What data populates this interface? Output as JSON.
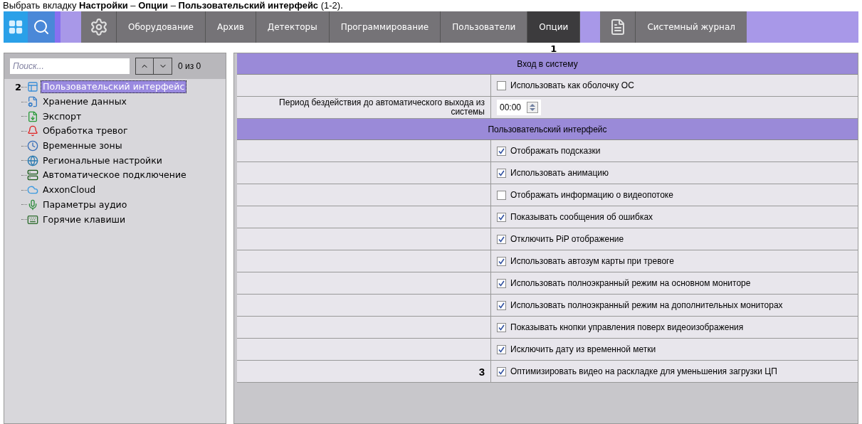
{
  "caption": "Выбрать вкладку **Настройки** – **Опции** – **Пользовательский интерфейс** (1-2).",
  "toolbar": {
    "tabs": [
      {
        "label": "Оборудование",
        "selected": false
      },
      {
        "label": "Архив",
        "selected": false
      },
      {
        "label": "Детекторы",
        "selected": false
      },
      {
        "label": "Программирование",
        "selected": false
      },
      {
        "label": "Пользователи",
        "selected": false
      },
      {
        "label": "Опции",
        "selected": true,
        "callout": "1"
      }
    ],
    "journal": "Системный журнал"
  },
  "sidebar": {
    "search": {
      "placeholder": "Поиск..."
    },
    "counter": "0 из 0",
    "items": [
      {
        "label": "Пользовательский интерфейс",
        "selected": true,
        "callout": "2"
      },
      {
        "label": "Хранение данных",
        "selected": false
      },
      {
        "label": "Экспорт",
        "selected": false
      },
      {
        "label": "Обработка тревог",
        "selected": false
      },
      {
        "label": "Временные зоны",
        "selected": false
      },
      {
        "label": "Региональные настройки",
        "selected": false
      },
      {
        "label": "Автоматическое подключение",
        "selected": false
      },
      {
        "label": "AxxonCloud",
        "selected": false
      },
      {
        "label": "Параметры аудио",
        "selected": false
      },
      {
        "label": "Горячие клавиши",
        "selected": false
      }
    ]
  },
  "sections": [
    {
      "title": "Вход в систему",
      "rows": [
        {
          "kind": "checkbox",
          "text": "Использовать как оболочку ОС",
          "checked": false
        },
        {
          "kind": "time",
          "label": "Период бездействия до автоматического выхода из системы",
          "value": "00:00"
        }
      ]
    },
    {
      "title": "Пользовательский интерфейс",
      "rows": [
        {
          "kind": "checkbox",
          "text": "Отображать подсказки",
          "checked": true
        },
        {
          "kind": "checkbox",
          "text": "Использовать анимацию",
          "checked": true
        },
        {
          "kind": "checkbox",
          "text": "Отображать информацию о видеопотоке",
          "checked": false
        },
        {
          "kind": "checkbox",
          "text": "Показывать сообщения об ошибках",
          "checked": true
        },
        {
          "kind": "checkbox",
          "text": "Отключить PiP отображение",
          "checked": true
        },
        {
          "kind": "checkbox",
          "text": "Использовать автозум карты при тревоге",
          "checked": true
        },
        {
          "kind": "checkbox",
          "text": "Использовать полноэкранный режим на основном мониторе",
          "checked": true
        },
        {
          "kind": "checkbox",
          "text": "Использовать полноэкранный режим на дополнительных мониторах",
          "checked": true
        },
        {
          "kind": "checkbox",
          "text": "Показывать кнопки управления поверх видеоизображения",
          "checked": true
        },
        {
          "kind": "checkbox",
          "text": "Исключить дату из временной метки",
          "checked": true
        },
        {
          "kind": "checkbox",
          "text": "Оптимизировать видео на раскладке для уменьшения загрузки ЦП",
          "checked": true,
          "callout": "3"
        }
      ]
    }
  ]
}
